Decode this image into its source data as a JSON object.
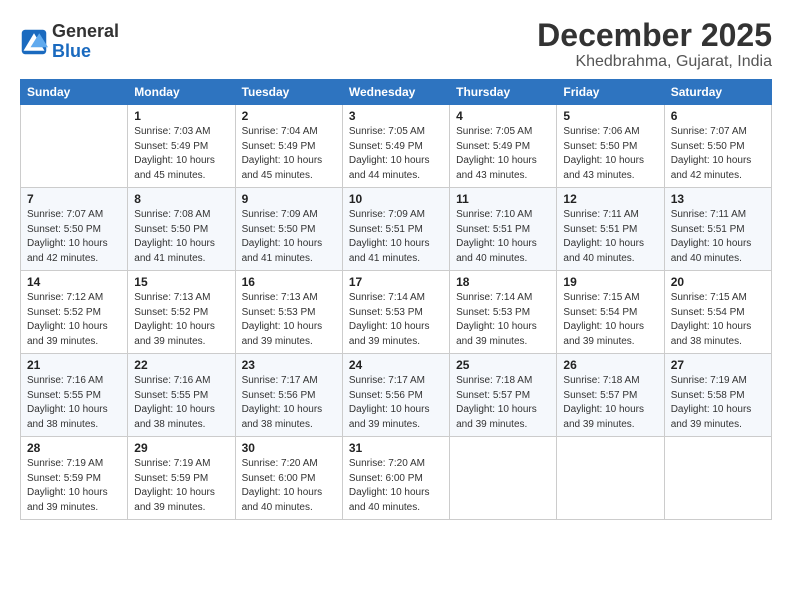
{
  "header": {
    "logo_line1": "General",
    "logo_line2": "Blue",
    "title": "December 2025",
    "subtitle": "Khedbrahma, Gujarat, India"
  },
  "columns": [
    "Sunday",
    "Monday",
    "Tuesday",
    "Wednesday",
    "Thursday",
    "Friday",
    "Saturday"
  ],
  "weeks": [
    [
      {
        "day": "",
        "info": ""
      },
      {
        "day": "1",
        "info": "Sunrise: 7:03 AM\nSunset: 5:49 PM\nDaylight: 10 hours\nand 45 minutes."
      },
      {
        "day": "2",
        "info": "Sunrise: 7:04 AM\nSunset: 5:49 PM\nDaylight: 10 hours\nand 45 minutes."
      },
      {
        "day": "3",
        "info": "Sunrise: 7:05 AM\nSunset: 5:49 PM\nDaylight: 10 hours\nand 44 minutes."
      },
      {
        "day": "4",
        "info": "Sunrise: 7:05 AM\nSunset: 5:49 PM\nDaylight: 10 hours\nand 43 minutes."
      },
      {
        "day": "5",
        "info": "Sunrise: 7:06 AM\nSunset: 5:50 PM\nDaylight: 10 hours\nand 43 minutes."
      },
      {
        "day": "6",
        "info": "Sunrise: 7:07 AM\nSunset: 5:50 PM\nDaylight: 10 hours\nand 42 minutes."
      }
    ],
    [
      {
        "day": "7",
        "info": "Sunrise: 7:07 AM\nSunset: 5:50 PM\nDaylight: 10 hours\nand 42 minutes."
      },
      {
        "day": "8",
        "info": "Sunrise: 7:08 AM\nSunset: 5:50 PM\nDaylight: 10 hours\nand 41 minutes."
      },
      {
        "day": "9",
        "info": "Sunrise: 7:09 AM\nSunset: 5:50 PM\nDaylight: 10 hours\nand 41 minutes."
      },
      {
        "day": "10",
        "info": "Sunrise: 7:09 AM\nSunset: 5:51 PM\nDaylight: 10 hours\nand 41 minutes."
      },
      {
        "day": "11",
        "info": "Sunrise: 7:10 AM\nSunset: 5:51 PM\nDaylight: 10 hours\nand 40 minutes."
      },
      {
        "day": "12",
        "info": "Sunrise: 7:11 AM\nSunset: 5:51 PM\nDaylight: 10 hours\nand 40 minutes."
      },
      {
        "day": "13",
        "info": "Sunrise: 7:11 AM\nSunset: 5:51 PM\nDaylight: 10 hours\nand 40 minutes."
      }
    ],
    [
      {
        "day": "14",
        "info": "Sunrise: 7:12 AM\nSunset: 5:52 PM\nDaylight: 10 hours\nand 39 minutes."
      },
      {
        "day": "15",
        "info": "Sunrise: 7:13 AM\nSunset: 5:52 PM\nDaylight: 10 hours\nand 39 minutes."
      },
      {
        "day": "16",
        "info": "Sunrise: 7:13 AM\nSunset: 5:53 PM\nDaylight: 10 hours\nand 39 minutes."
      },
      {
        "day": "17",
        "info": "Sunrise: 7:14 AM\nSunset: 5:53 PM\nDaylight: 10 hours\nand 39 minutes."
      },
      {
        "day": "18",
        "info": "Sunrise: 7:14 AM\nSunset: 5:53 PM\nDaylight: 10 hours\nand 39 minutes."
      },
      {
        "day": "19",
        "info": "Sunrise: 7:15 AM\nSunset: 5:54 PM\nDaylight: 10 hours\nand 39 minutes."
      },
      {
        "day": "20",
        "info": "Sunrise: 7:15 AM\nSunset: 5:54 PM\nDaylight: 10 hours\nand 38 minutes."
      }
    ],
    [
      {
        "day": "21",
        "info": "Sunrise: 7:16 AM\nSunset: 5:55 PM\nDaylight: 10 hours\nand 38 minutes."
      },
      {
        "day": "22",
        "info": "Sunrise: 7:16 AM\nSunset: 5:55 PM\nDaylight: 10 hours\nand 38 minutes."
      },
      {
        "day": "23",
        "info": "Sunrise: 7:17 AM\nSunset: 5:56 PM\nDaylight: 10 hours\nand 38 minutes."
      },
      {
        "day": "24",
        "info": "Sunrise: 7:17 AM\nSunset: 5:56 PM\nDaylight: 10 hours\nand 39 minutes."
      },
      {
        "day": "25",
        "info": "Sunrise: 7:18 AM\nSunset: 5:57 PM\nDaylight: 10 hours\nand 39 minutes."
      },
      {
        "day": "26",
        "info": "Sunrise: 7:18 AM\nSunset: 5:57 PM\nDaylight: 10 hours\nand 39 minutes."
      },
      {
        "day": "27",
        "info": "Sunrise: 7:19 AM\nSunset: 5:58 PM\nDaylight: 10 hours\nand 39 minutes."
      }
    ],
    [
      {
        "day": "28",
        "info": "Sunrise: 7:19 AM\nSunset: 5:59 PM\nDaylight: 10 hours\nand 39 minutes."
      },
      {
        "day": "29",
        "info": "Sunrise: 7:19 AM\nSunset: 5:59 PM\nDaylight: 10 hours\nand 39 minutes."
      },
      {
        "day": "30",
        "info": "Sunrise: 7:20 AM\nSunset: 6:00 PM\nDaylight: 10 hours\nand 40 minutes."
      },
      {
        "day": "31",
        "info": "Sunrise: 7:20 AM\nSunset: 6:00 PM\nDaylight: 10 hours\nand 40 minutes."
      },
      {
        "day": "",
        "info": ""
      },
      {
        "day": "",
        "info": ""
      },
      {
        "day": "",
        "info": ""
      }
    ]
  ]
}
